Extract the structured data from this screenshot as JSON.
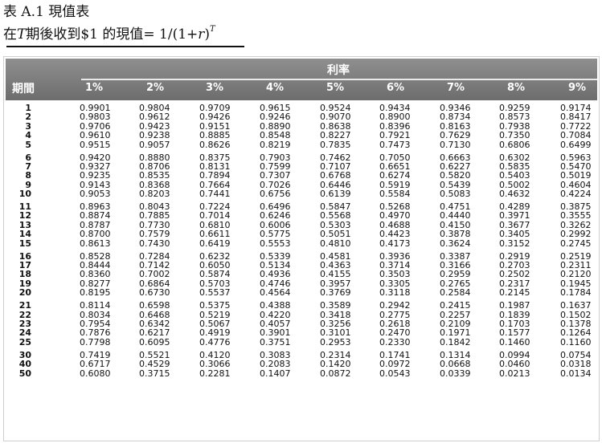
{
  "caption": {
    "title": "表 A.1  現值表",
    "subtitle_pre": "在",
    "subtitle_T": "T",
    "subtitle_mid": "期後收到$1 的現值= 1/(1+",
    "subtitle_r": "r",
    "subtitle_close": ")",
    "subtitle_sup": "T"
  },
  "table": {
    "rate_label": "利率",
    "period_label": "期間",
    "rate_headers": [
      "1%",
      "2%",
      "3%",
      "4%",
      "5%",
      "6%",
      "7%",
      "8%",
      "9%"
    ],
    "rows": [
      {
        "period": "1",
        "values": [
          "0.9901",
          "0.9804",
          "0.9709",
          "0.9615",
          "0.9524",
          "0.9434",
          "0.9346",
          "0.9259",
          "0.9174"
        ]
      },
      {
        "period": "2",
        "values": [
          "0.9803",
          "0.9612",
          "0.9426",
          "0.9246",
          "0.9070",
          "0.8900",
          "0.8734",
          "0.8573",
          "0.8417"
        ]
      },
      {
        "period": "3",
        "values": [
          "0.9706",
          "0.9423",
          "0.9151",
          "0.8890",
          "0.8638",
          "0.8396",
          "0.8163",
          "0.7938",
          "0.7722"
        ]
      },
      {
        "period": "4",
        "values": [
          "0.9610",
          "0.9238",
          "0.8885",
          "0.8548",
          "0.8227",
          "0.7921",
          "0.7629",
          "0.7350",
          "0.7084"
        ]
      },
      {
        "period": "5",
        "values": [
          "0.9515",
          "0.9057",
          "0.8626",
          "0.8219",
          "0.7835",
          "0.7473",
          "0.7130",
          "0.6806",
          "0.6499"
        ]
      },
      {
        "period": "6",
        "values": [
          "0.9420",
          "0.8880",
          "0.8375",
          "0.7903",
          "0.7462",
          "0.7050",
          "0.6663",
          "0.6302",
          "0.5963"
        ]
      },
      {
        "period": "7",
        "values": [
          "0.9327",
          "0.8706",
          "0.8131",
          "0.7599",
          "0.7107",
          "0.6651",
          "0.6227",
          "0.5835",
          "0.5470"
        ]
      },
      {
        "period": "8",
        "values": [
          "0.9235",
          "0.8535",
          "0.7894",
          "0.7307",
          "0.6768",
          "0.6274",
          "0.5820",
          "0.5403",
          "0.5019"
        ]
      },
      {
        "period": "9",
        "values": [
          "0.9143",
          "0.8368",
          "0.7664",
          "0.7026",
          "0.6446",
          "0.5919",
          "0.5439",
          "0.5002",
          "0.4604"
        ]
      },
      {
        "period": "10",
        "values": [
          "0.9053",
          "0.8203",
          "0.7441",
          "0.6756",
          "0.6139",
          "0.5584",
          "0.5083",
          "0.4632",
          "0.4224"
        ]
      },
      {
        "period": "11",
        "values": [
          "0.8963",
          "0.8043",
          "0.7224",
          "0.6496",
          "0.5847",
          "0.5268",
          "0.4751",
          "0.4289",
          "0.3875"
        ]
      },
      {
        "period": "12",
        "values": [
          "0.8874",
          "0.7885",
          "0.7014",
          "0.6246",
          "0.5568",
          "0.4970",
          "0.4440",
          "0.3971",
          "0.3555"
        ]
      },
      {
        "period": "13",
        "values": [
          "0.8787",
          "0.7730",
          "0.6810",
          "0.6006",
          "0.5303",
          "0.4688",
          "0.4150",
          "0.3677",
          "0.3262"
        ]
      },
      {
        "period": "14",
        "values": [
          "0.8700",
          "0.7579",
          "0.6611",
          "0.5775",
          "0.5051",
          "0.4423",
          "0.3878",
          "0.3405",
          "0.2992"
        ]
      },
      {
        "period": "15",
        "values": [
          "0.8613",
          "0.7430",
          "0.6419",
          "0.5553",
          "0.4810",
          "0.4173",
          "0.3624",
          "0.3152",
          "0.2745"
        ]
      },
      {
        "period": "16",
        "values": [
          "0.8528",
          "0.7284",
          "0.6232",
          "0.5339",
          "0.4581",
          "0.3936",
          "0.3387",
          "0.2919",
          "0.2519"
        ]
      },
      {
        "period": "17",
        "values": [
          "0.8444",
          "0.7142",
          "0.6050",
          "0.5134",
          "0.4363",
          "0.3714",
          "0.3166",
          "0.2703",
          "0.2311"
        ]
      },
      {
        "period": "18",
        "values": [
          "0.8360",
          "0.7002",
          "0.5874",
          "0.4936",
          "0.4155",
          "0.3503",
          "0.2959",
          "0.2502",
          "0.2120"
        ]
      },
      {
        "period": "19",
        "values": [
          "0.8277",
          "0.6864",
          "0.5703",
          "0.4746",
          "0.3957",
          "0.3305",
          "0.2765",
          "0.2317",
          "0.1945"
        ]
      },
      {
        "period": "20",
        "values": [
          "0.8195",
          "0.6730",
          "0.5537",
          "0.4564",
          "0.3769",
          "0.3118",
          "0.2584",
          "0.2145",
          "0.1784"
        ]
      },
      {
        "period": "21",
        "values": [
          "0.8114",
          "0.6598",
          "0.5375",
          "0.4388",
          "0.3589",
          "0.2942",
          "0.2415",
          "0.1987",
          "0.1637"
        ]
      },
      {
        "period": "22",
        "values": [
          "0.8034",
          "0.6468",
          "0.5219",
          "0.4220",
          "0.3418",
          "0.2775",
          "0.2257",
          "0.1839",
          "0.1502"
        ]
      },
      {
        "period": "23",
        "values": [
          "0.7954",
          "0.6342",
          "0.5067",
          "0.4057",
          "0.3256",
          "0.2618",
          "0.2109",
          "0.1703",
          "0.1378"
        ]
      },
      {
        "period": "24",
        "values": [
          "0.7876",
          "0.6217",
          "0.4919",
          "0.3901",
          "0.3101",
          "0.2470",
          "0.1971",
          "0.1577",
          "0.1264"
        ]
      },
      {
        "period": "25",
        "values": [
          "0.7798",
          "0.6095",
          "0.4776",
          "0.3751",
          "0.2953",
          "0.2330",
          "0.1842",
          "0.1460",
          "0.1160"
        ]
      },
      {
        "period": "30",
        "values": [
          "0.7419",
          "0.5521",
          "0.4120",
          "0.3083",
          "0.2314",
          "0.1741",
          "0.1314",
          "0.0994",
          "0.0754"
        ]
      },
      {
        "period": "40",
        "values": [
          "0.6717",
          "0.4529",
          "0.3066",
          "0.2083",
          "0.1420",
          "0.0972",
          "0.0668",
          "0.0460",
          "0.0318"
        ]
      },
      {
        "period": "50",
        "values": [
          "0.6080",
          "0.3715",
          "0.2281",
          "0.1407",
          "0.0872",
          "0.0543",
          "0.0339",
          "0.0213",
          "0.0134"
        ]
      }
    ]
  }
}
